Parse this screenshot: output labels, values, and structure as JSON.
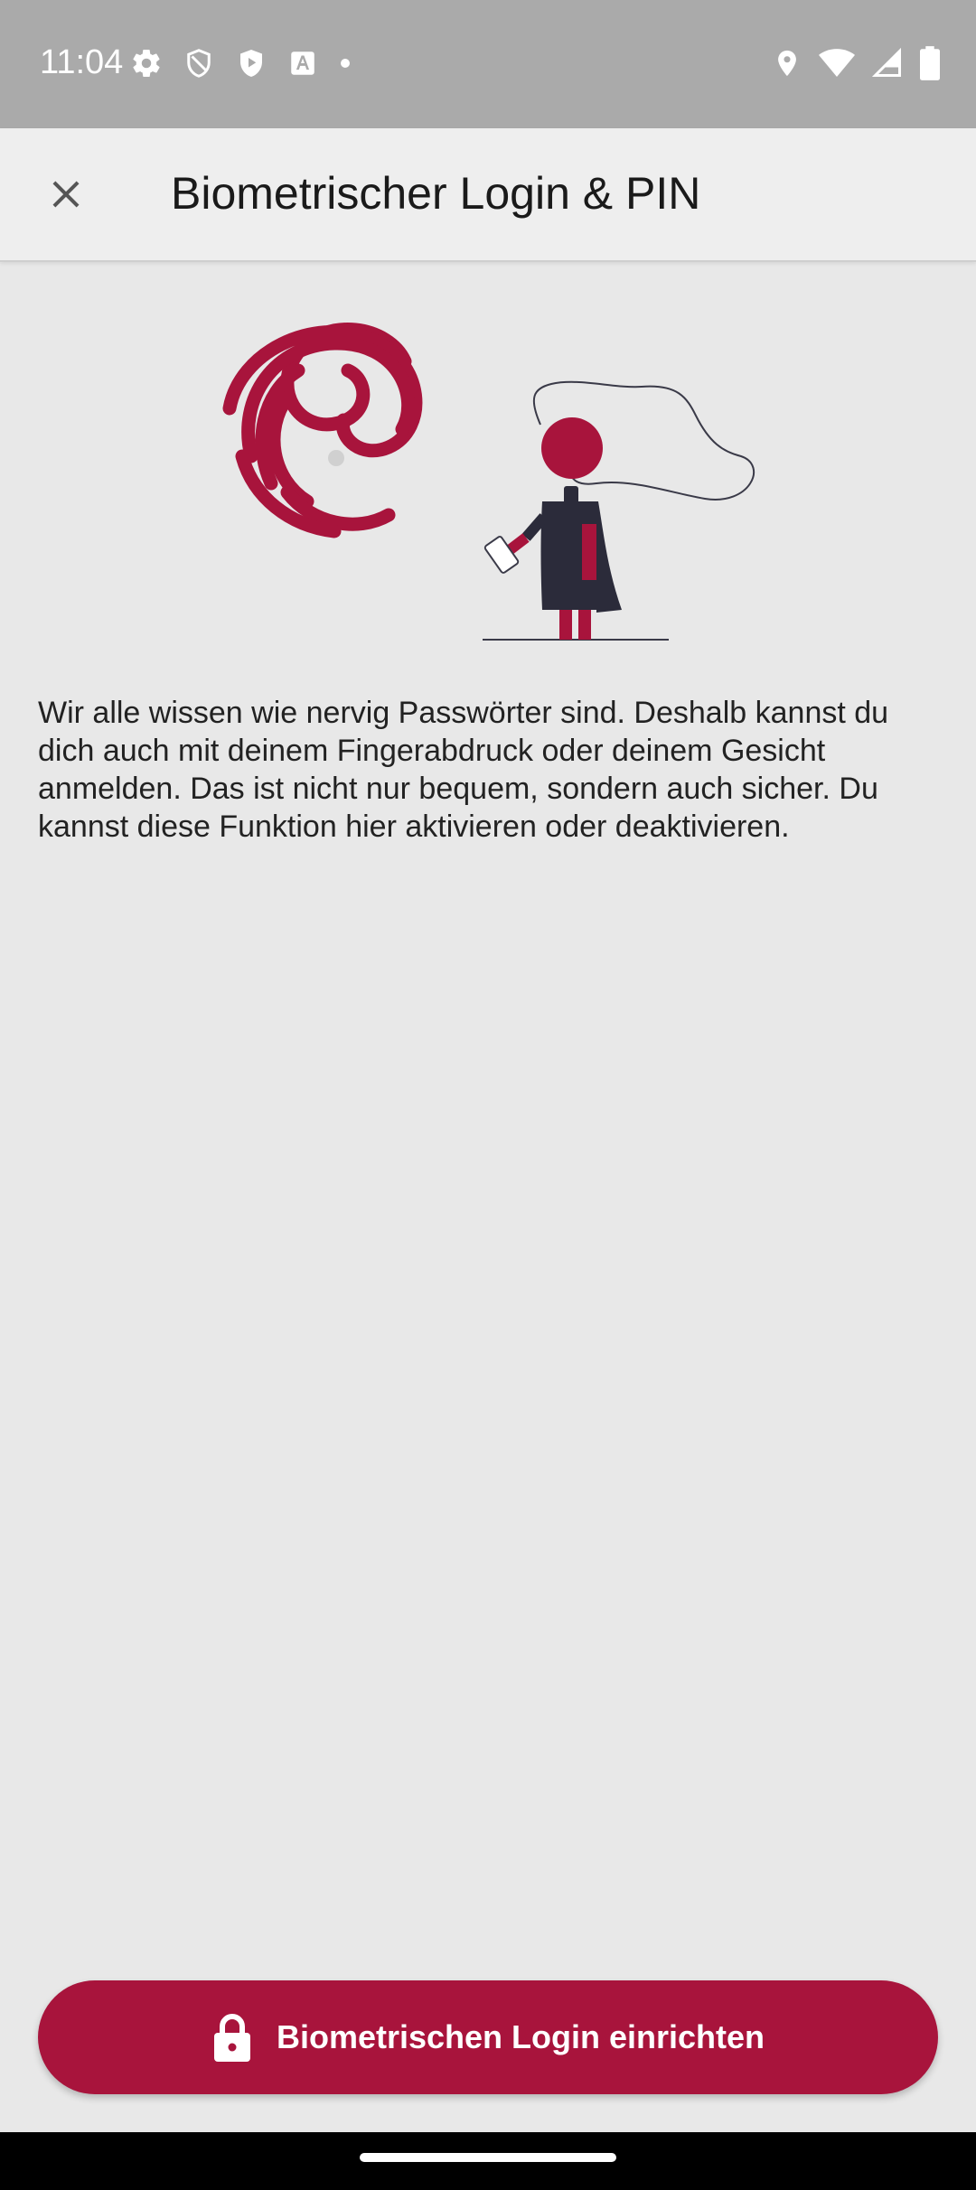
{
  "status_bar": {
    "time": "11:04",
    "left_icons": [
      "settings-icon",
      "shield-icon",
      "play-protect-icon",
      "font-app-icon",
      "notification-dot-icon"
    ],
    "right_icons": [
      "location-icon",
      "wifi-icon",
      "cellular-signal-icon",
      "battery-icon"
    ]
  },
  "app_bar": {
    "close_icon": "close-icon",
    "title": "Biometrischer Login & PIN"
  },
  "illustration": {
    "name": "fingerprint-person-illustration",
    "colors": {
      "accent": "#a8143c",
      "dark": "#2b2b3a",
      "line": "#3a3a48"
    }
  },
  "content": {
    "description": "Wir alle wissen wie nervig Passwörter sind. Deshalb kannst du dich auch mit deinem Fingerabdruck oder deinem Gesicht anmelden. Das ist nicht nur bequem, sondern auch sicher. Du kannst diese Funktion hier aktivieren oder deaktivieren."
  },
  "actions": {
    "setup_button_label": "Biometrischen Login einrichten",
    "setup_button_icon": "lock-icon",
    "button_color": "#a8143c"
  }
}
